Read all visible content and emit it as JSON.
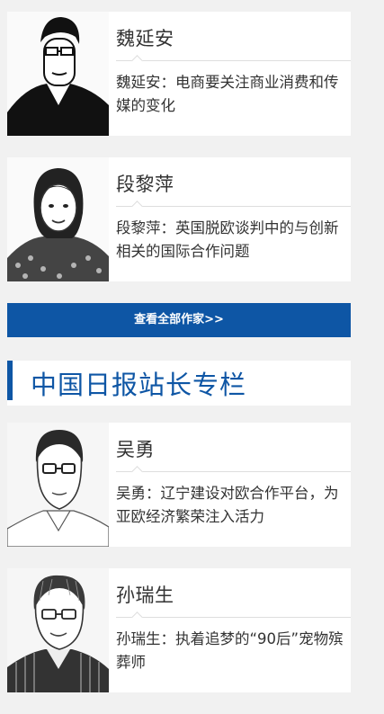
{
  "columnists": [
    {
      "name": "魏延安",
      "title": "魏延安：电商要关注商业消费和传媒的变化",
      "photo_icon": "portrait-man-glasses-icon"
    },
    {
      "name": "段黎萍",
      "title": "段黎萍：英国脱欧谈判中的与创新相关的国际合作问题",
      "photo_icon": "portrait-woman-icon"
    }
  ],
  "view_all_button": "查看全部作家>>",
  "section": {
    "title": "中国日报站长专栏"
  },
  "station_chiefs": [
    {
      "name": "吴勇",
      "title": "吴勇：辽宁建设对欧合作平台，为亚欧经济繁荣注入活力",
      "photo_icon": "portrait-man-glasses-icon"
    },
    {
      "name": "孙瑞生",
      "title": "孙瑞生：执着追梦的“90后”宠物殡葬师",
      "photo_icon": "portrait-man-glasses-icon"
    }
  ],
  "colors": {
    "accent": "#0e56a5",
    "background": "#f1f1f1",
    "card": "#ffffff"
  }
}
